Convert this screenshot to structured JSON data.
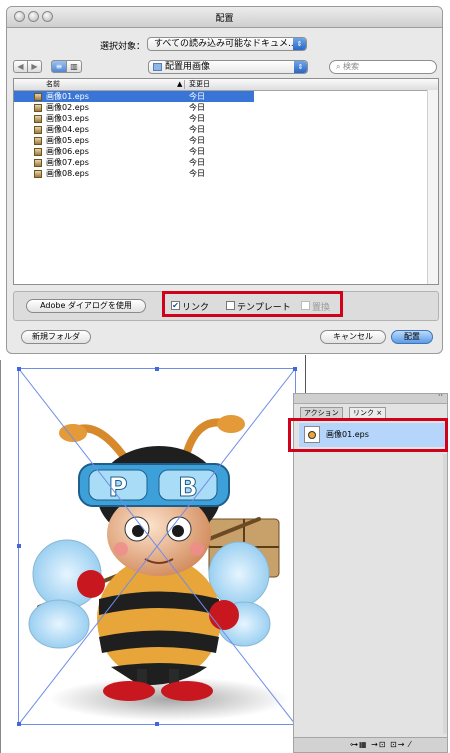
{
  "dialog": {
    "title": "配置",
    "show_label": "選択対象：",
    "show_value": "すべての読み込み可能なドキュメ...",
    "location_value": "配置用画像",
    "search_placeholder": "検索",
    "nav_back": "◀",
    "nav_forward": "▶",
    "view_list": "≡",
    "view_columns": "▥",
    "columns": {
      "name": "名前",
      "date": "変更日"
    },
    "files": [
      {
        "name": "画像01.eps",
        "date": "今日",
        "selected": true
      },
      {
        "name": "画像02.eps",
        "date": "今日",
        "selected": false
      },
      {
        "name": "画像03.eps",
        "date": "今日",
        "selected": false
      },
      {
        "name": "画像04.eps",
        "date": "今日",
        "selected": false
      },
      {
        "name": "画像05.eps",
        "date": "今日",
        "selected": false
      },
      {
        "name": "画像06.eps",
        "date": "今日",
        "selected": false
      },
      {
        "name": "画像07.eps",
        "date": "今日",
        "selected": false
      },
      {
        "name": "画像08.eps",
        "date": "今日",
        "selected": false
      }
    ],
    "adobe_dialog_button": "Adobe ダイアログを使用",
    "options": {
      "link": {
        "label": "リンク",
        "checked": true
      },
      "template": {
        "label": "テンプレート",
        "checked": false
      },
      "replace": {
        "label": "置換",
        "checked": false,
        "disabled": true
      }
    },
    "new_folder_button": "新規フォルダ",
    "cancel_button": "キャンセル",
    "place_button": "配置"
  },
  "art": {
    "goggle_letters": "PB"
  },
  "links_panel": {
    "tabs": [
      "アクション",
      "リンク ×"
    ],
    "items": [
      {
        "name": "画像01.eps"
      }
    ],
    "bottom_tools": "⊶▦ →⊡ ⊡→ ⁄"
  },
  "colors": {
    "highlight": "#d0021b",
    "selection": "#3875d7",
    "link_selection": "#b5d5fb"
  }
}
